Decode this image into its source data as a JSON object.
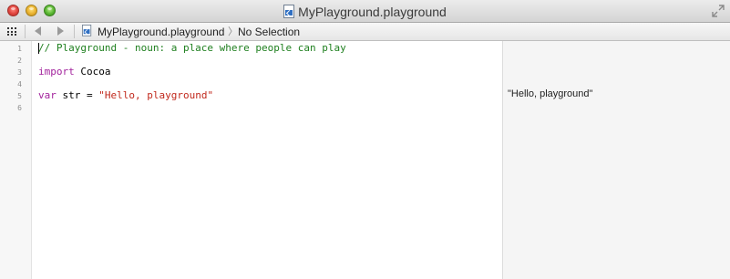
{
  "window": {
    "title": "MyPlayground.playground",
    "icons": {
      "close": "close-button",
      "minimize": "minimize-button",
      "zoom": "zoom-button",
      "document": "playground-document-icon",
      "fullscreen": "fullscreen-arrows-icon"
    }
  },
  "jumpbar": {
    "icons": [
      "related-items-grid-icon",
      "back-arrow-icon",
      "forward-arrow-icon",
      "playground-document-icon"
    ],
    "file": "MyPlayground.playground",
    "chevron": "〉",
    "selection": "No Selection"
  },
  "editor": {
    "line_numbers": [
      "1",
      "2",
      "3",
      "4",
      "5",
      "6"
    ],
    "lines": {
      "comment": "// Playground - noun: a place where people can play",
      "import_kw": "import",
      "import_module": "Cocoa",
      "var_kw": "var",
      "var_rest": " str = ",
      "string_literal": "\"Hello, playground\""
    },
    "colors": {
      "comment": "#1e7f1e",
      "keyword": "#a2229c",
      "string": "#c1281c"
    }
  },
  "results": {
    "line5": "\"Hello, playground\""
  }
}
